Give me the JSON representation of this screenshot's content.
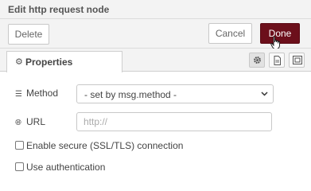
{
  "dialog": {
    "title": "Edit http request node"
  },
  "toolbar": {
    "delete_label": "Delete",
    "cancel_label": "Cancel",
    "done_label": "Done"
  },
  "tabs": {
    "properties_label": "Properties",
    "icons": [
      "gear-icon",
      "description-icon",
      "appearance-icon"
    ]
  },
  "form": {
    "method": {
      "label": "Method",
      "icon": "list-icon",
      "selected": "- set by msg.method -"
    },
    "url": {
      "label": "URL",
      "icon": "globe-icon",
      "value": "",
      "placeholder": "http://"
    },
    "tls": {
      "label": "Enable secure (SSL/TLS) connection",
      "checked": false
    },
    "auth": {
      "label": "Use authentication",
      "checked": false
    }
  },
  "colors": {
    "done_bg": "#6c0f1b",
    "toolbar_bg": "#f3f3f3"
  }
}
